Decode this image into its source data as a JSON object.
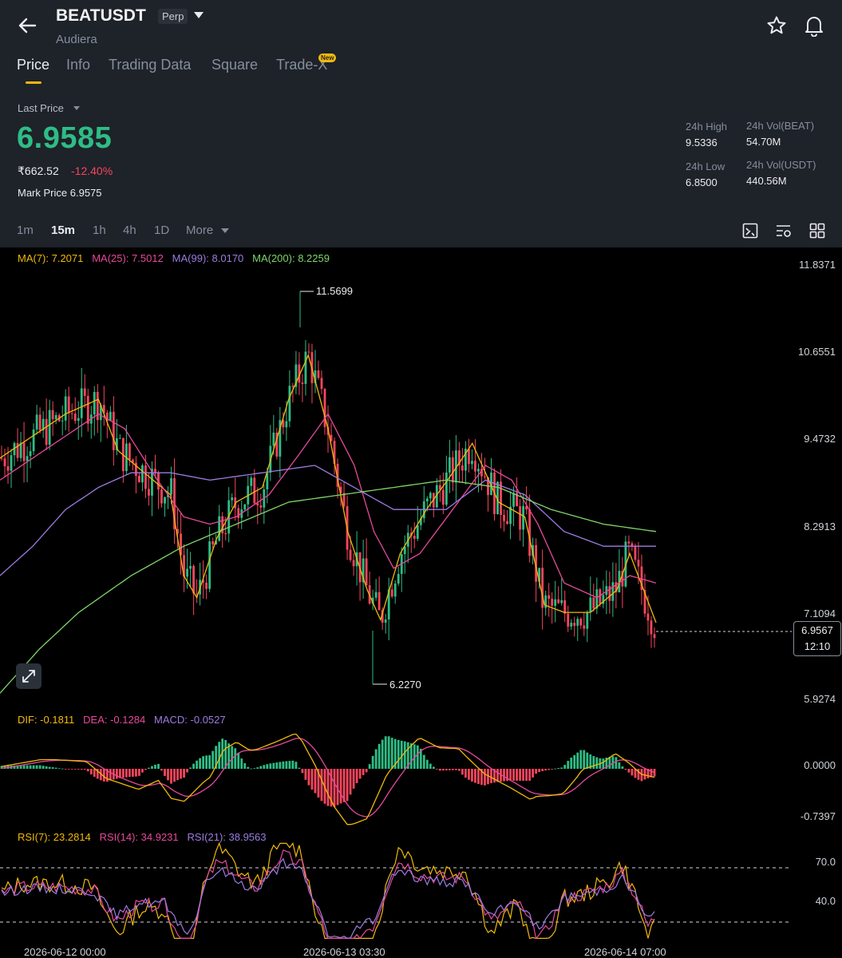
{
  "header": {
    "symbol": "BEATUSDT",
    "contract_type": "Perp",
    "subtitle": "Audiera"
  },
  "tabs": [
    "Price",
    "Info",
    "Trading Data",
    "Square",
    "Trade-X"
  ],
  "new_badge": "New",
  "ticker": {
    "last_price_label": "Last Price",
    "last_price": "6.9585",
    "inr_price": "₹662.52",
    "change_pct": "-12.40%",
    "mark_price_label": "Mark Price",
    "mark_price": "6.9575"
  },
  "stats": {
    "high_label": "24h High",
    "high": "9.5336",
    "low_label": "24h Low",
    "low": "6.8500",
    "vol_base_label": "24h Vol(BEAT)",
    "vol_base": "54.70M",
    "vol_quote_label": "24h Vol(USDT)",
    "vol_quote": "440.56M"
  },
  "intervals": [
    "1m",
    "15m",
    "1h",
    "4h",
    "1D",
    "More"
  ],
  "selected_interval": "15m",
  "icons": [
    "back-arrow-icon",
    "star-icon",
    "bell-icon",
    "chart-settings-icon",
    "indicator-settings-icon",
    "grid-layout-icon",
    "expand-icon"
  ],
  "colors": {
    "up": "#2ebd85",
    "down": "#f6465d",
    "accent": "#f0b90b",
    "ma7": "#f0b90b",
    "ma25": "#e6499b",
    "ma99": "#9c7ce0",
    "ma200": "#7fd66a",
    "dif": "#f0b90b",
    "dea": "#e6499b",
    "macd": "#9c7ce0"
  },
  "legends": {
    "ma": [
      {
        "label": "MA(7): 7.2071",
        "color": "#f0b90b"
      },
      {
        "label": "MA(25): 7.5012",
        "color": "#e6499b"
      },
      {
        "label": "MA(99): 8.0170",
        "color": "#9c7ce0"
      },
      {
        "label": "MA(200): 8.2259",
        "color": "#7fd66a"
      }
    ],
    "macd": [
      {
        "label": "DIF: -0.1811",
        "color": "#f0b90b"
      },
      {
        "label": "DEA: -0.1284",
        "color": "#e6499b"
      },
      {
        "label": "MACD: -0.0527",
        "color": "#9c7ce0"
      }
    ],
    "rsi": [
      {
        "label": "RSI(7): 23.2814",
        "color": "#f0b90b"
      },
      {
        "label": "RSI(14): 34.9231",
        "color": "#e6499b"
      },
      {
        "label": "RSI(21): 38.9563",
        "color": "#9c7ce0"
      }
    ]
  },
  "price_axis": [
    "11.8371",
    "10.6551",
    "9.4732",
    "8.2913",
    "7.1094",
    "5.9274"
  ],
  "macd_axis": [
    "0.0000",
    "-0.7397"
  ],
  "rsi_axis": [
    "70.0",
    "40.0"
  ],
  "time_axis": [
    "2026-06-12 00:00",
    "2026-06-13 03:30",
    "2026-06-14 07:00"
  ],
  "current_price_tag": {
    "price": "6.9567",
    "countdown": "12:10"
  },
  "high_marker": "11.5699",
  "low_marker": "6.2270",
  "chart_data": {
    "type": "candlestick",
    "price_range": [
      5.9274,
      11.8371
    ],
    "ma_shape": {
      "ma7": [
        [
          0,
          9.2
        ],
        [
          0.05,
          9.5
        ],
        [
          0.1,
          9.8
        ],
        [
          0.15,
          10.0
        ],
        [
          0.18,
          9.3
        ],
        [
          0.22,
          9.0
        ],
        [
          0.26,
          8.7
        ],
        [
          0.28,
          7.6
        ],
        [
          0.3,
          7.3
        ],
        [
          0.33,
          8.1
        ],
        [
          0.36,
          8.6
        ],
        [
          0.4,
          8.8
        ],
        [
          0.44,
          10.0
        ],
        [
          0.47,
          10.6
        ],
        [
          0.5,
          9.6
        ],
        [
          0.53,
          8.2
        ],
        [
          0.56,
          7.4
        ],
        [
          0.58,
          7.0
        ],
        [
          0.61,
          7.9
        ],
        [
          0.65,
          8.5
        ],
        [
          0.69,
          9.0
        ],
        [
          0.72,
          9.4
        ],
        [
          0.76,
          8.6
        ],
        [
          0.8,
          8.4
        ],
        [
          0.83,
          7.2
        ],
        [
          0.86,
          7.1
        ],
        [
          0.9,
          7.1
        ],
        [
          0.94,
          7.4
        ],
        [
          0.96,
          7.9
        ],
        [
          1.0,
          6.96
        ]
      ],
      "ma25": [
        [
          0,
          8.9
        ],
        [
          0.05,
          9.2
        ],
        [
          0.1,
          9.5
        ],
        [
          0.15,
          9.8
        ],
        [
          0.19,
          9.6
        ],
        [
          0.24,
          8.9
        ],
        [
          0.28,
          8.4
        ],
        [
          0.32,
          8.3
        ],
        [
          0.36,
          8.4
        ],
        [
          0.41,
          8.7
        ],
        [
          0.46,
          9.3
        ],
        [
          0.5,
          9.8
        ],
        [
          0.54,
          9.1
        ],
        [
          0.57,
          8.2
        ],
        [
          0.6,
          7.7
        ],
        [
          0.64,
          7.9
        ],
        [
          0.69,
          8.5
        ],
        [
          0.74,
          9.1
        ],
        [
          0.78,
          8.9
        ],
        [
          0.82,
          8.3
        ],
        [
          0.86,
          7.5
        ],
        [
          0.91,
          7.3
        ],
        [
          0.96,
          7.6
        ],
        [
          1.0,
          7.5
        ]
      ],
      "ma99": [
        [
          0,
          7.6
        ],
        [
          0.05,
          8.0
        ],
        [
          0.1,
          8.5
        ],
        [
          0.15,
          8.8
        ],
        [
          0.2,
          9.0
        ],
        [
          0.26,
          9.0
        ],
        [
          0.32,
          8.9
        ],
        [
          0.4,
          9.0
        ],
        [
          0.48,
          9.1
        ],
        [
          0.54,
          8.8
        ],
        [
          0.6,
          8.5
        ],
        [
          0.68,
          8.5
        ],
        [
          0.74,
          8.9
        ],
        [
          0.8,
          8.7
        ],
        [
          0.86,
          8.2
        ],
        [
          0.92,
          8.0
        ],
        [
          1.0,
          8.0
        ]
      ],
      "ma200": [
        [
          0,
          6.0
        ],
        [
          0.06,
          6.6
        ],
        [
          0.12,
          7.1
        ],
        [
          0.2,
          7.6
        ],
        [
          0.28,
          8.0
        ],
        [
          0.36,
          8.3
        ],
        [
          0.44,
          8.6
        ],
        [
          0.52,
          8.7
        ],
        [
          0.6,
          8.8
        ],
        [
          0.68,
          8.9
        ],
        [
          0.76,
          8.8
        ],
        [
          0.84,
          8.5
        ],
        [
          0.92,
          8.3
        ],
        [
          1.0,
          8.2
        ]
      ]
    }
  }
}
